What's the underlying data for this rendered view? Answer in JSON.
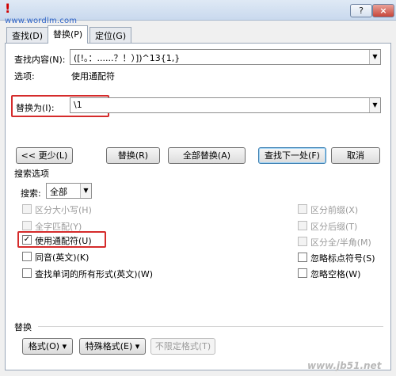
{
  "title_mark": "!",
  "watermark_top": "www.wordlm.com",
  "watermark_bottom": "www.jb51.net",
  "titlebar": {
    "help": "?",
    "close": "×"
  },
  "tabs": [
    {
      "label": "查找(D)"
    },
    {
      "label": "替换(P)"
    },
    {
      "label": "定位(G)"
    }
  ],
  "find": {
    "label": "查找内容(N):",
    "value": "([!。：......？！）])^13{1,}"
  },
  "options": {
    "label": "选项:",
    "value": "使用通配符"
  },
  "replace": {
    "label": "替换为(I):",
    "value": "\\1"
  },
  "buttons": {
    "less": "<< 更少(L)",
    "replace": "替换(R)",
    "replace_all": "全部替换(A)",
    "find_next": "查找下一处(F)",
    "cancel": "取消"
  },
  "search_options": {
    "heading": "搜索选项",
    "search_label": "搜索:",
    "search_value": "全部"
  },
  "checkboxes_left": [
    {
      "label": "区分大小写(H)",
      "checked": false,
      "enabled": false
    },
    {
      "label": "全字匹配(Y)",
      "checked": false,
      "enabled": false
    },
    {
      "label": "使用通配符(U)",
      "checked": true,
      "enabled": true
    },
    {
      "label": "同音(英文)(K)",
      "checked": false,
      "enabled": true
    },
    {
      "label": "查找单词的所有形式(英文)(W)",
      "checked": false,
      "enabled": true
    }
  ],
  "checkboxes_right": [
    {
      "label": "区分前缀(X)",
      "checked": false,
      "enabled": false
    },
    {
      "label": "区分后缀(T)",
      "checked": false,
      "enabled": false
    },
    {
      "label": "区分全/半角(M)",
      "checked": false,
      "enabled": false
    },
    {
      "label": "忽略标点符号(S)",
      "checked": false,
      "enabled": true
    },
    {
      "label": "忽略空格(W)",
      "checked": false,
      "enabled": true
    }
  ],
  "replace_section": {
    "heading": "替换",
    "format": "格式(O) ▾",
    "special": "特殊格式(E) ▾",
    "no_format": "不限定格式(T)"
  },
  "check_mark": "✓",
  "dropdown_arrow": "▼"
}
